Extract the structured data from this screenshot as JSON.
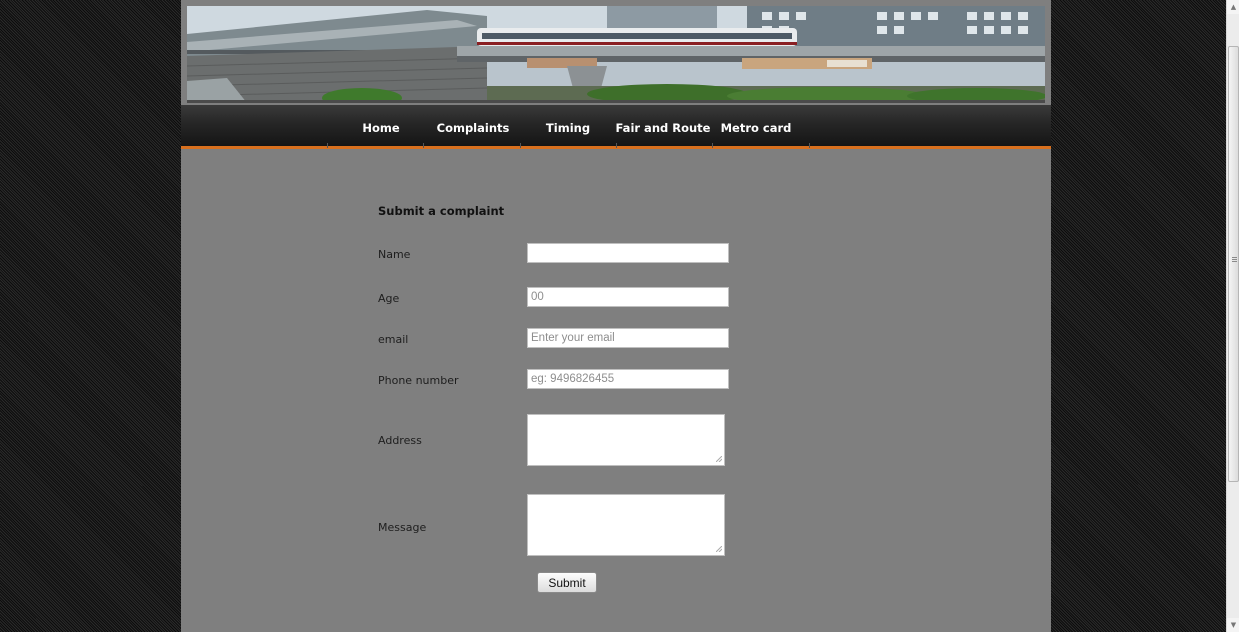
{
  "nav": {
    "items": [
      {
        "label": "Home"
      },
      {
        "label": "Complaints"
      },
      {
        "label": "Timing"
      },
      {
        "label": "Fair and Route"
      },
      {
        "label": "Metro card"
      }
    ]
  },
  "form": {
    "title": "Submit a complaint",
    "fields": {
      "name": {
        "label": "Name",
        "value": "",
        "placeholder": ""
      },
      "age": {
        "label": "Age",
        "value": "",
        "placeholder": "00"
      },
      "email": {
        "label": "email",
        "value": "",
        "placeholder": "Enter your email"
      },
      "phone": {
        "label": "Phone number",
        "value": "",
        "placeholder": "eg: 9496826455"
      },
      "address": {
        "label": "Address",
        "value": ""
      },
      "message": {
        "label": "Message",
        "value": ""
      }
    },
    "submit_label": "Submit"
  },
  "theme": {
    "page_bg": "#7f7f7f",
    "nav_bg": "#1f1f1f",
    "nav_accent": "#d9701e",
    "outer_bg": "#141414"
  },
  "icons": {
    "banner": "metro-train-banner-image",
    "scroll_up": "scroll-up-arrow-icon",
    "scroll_down": "scroll-down-arrow-icon",
    "resize": "textarea-resize-grip-icon"
  }
}
